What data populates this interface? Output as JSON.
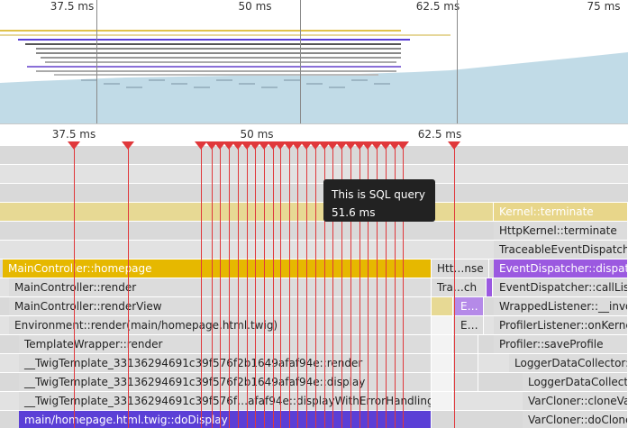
{
  "overview": {
    "ticks": [
      {
        "label": "37.5 ms",
        "ms": 37.5
      },
      {
        "label": "50 ms",
        "ms": 50
      },
      {
        "label": "62.5 ms",
        "ms": 62.5
      },
      {
        "label": "75 ms",
        "ms": 75
      }
    ],
    "selection_ms": [
      32.0,
      87.5
    ]
  },
  "timeline": {
    "ticks": [
      {
        "label": "37.5 ms",
        "ms": 37.5
      },
      {
        "label": "50 ms",
        "ms": 50
      },
      {
        "label": "62.5 ms",
        "ms": 62.5
      }
    ],
    "markers_ms": [
      37.5,
      41.2,
      46.2,
      46.9,
      47.5,
      48.1,
      48.7,
      49.3,
      49.9,
      50.5,
      51.1,
      51.6,
      52.2,
      52.8,
      53.4,
      54.0,
      54.6,
      55.2,
      55.8,
      56.4,
      57.0,
      57.6,
      58.2,
      58.8,
      59.4,
      60.0,
      63.5
    ],
    "tooltip": {
      "title": "This is SQL query",
      "duration": "51.6 ms"
    },
    "bars": [
      {
        "row": 3,
        "start": 0,
        "end": 548,
        "style": "c-lgold",
        "label": ""
      },
      {
        "row": 3,
        "start": 548,
        "end": 697,
        "style": "c-goldtext",
        "label": "Kernel::terminate"
      },
      {
        "row": 4,
        "start": 548,
        "end": 697,
        "style": "c-lgray",
        "label": "HttpKernel::terminate"
      },
      {
        "row": 5,
        "start": 548,
        "end": 697,
        "style": "c-lgray",
        "label": "TraceableEventDispatcher"
      },
      {
        "row": 6,
        "start": 3,
        "end": 479,
        "style": "c-gold",
        "label": "MainController::homepage"
      },
      {
        "row": 6,
        "start": 479,
        "end": 543,
        "style": "c-lgray",
        "label": "Htt…nse"
      },
      {
        "row": 6,
        "start": 548,
        "end": 697,
        "style": "c-purple",
        "label": "EventDispatcher::dispatch"
      },
      {
        "row": 7,
        "start": 10,
        "end": 479,
        "style": "c-lgray",
        "label": "MainController::render"
      },
      {
        "row": 7,
        "start": 479,
        "end": 540,
        "style": "c-lgray",
        "label": "Tra…ch"
      },
      {
        "row": 7,
        "start": 540,
        "end": 543,
        "style": "c-purple",
        "label": ""
      },
      {
        "row": 7,
        "start": 548,
        "end": 697,
        "style": "c-lgray",
        "label": "EventDispatcher::callList"
      },
      {
        "row": 8,
        "start": 10,
        "end": 479,
        "style": "c-lgray",
        "label": "MainController::renderView"
      },
      {
        "row": 8,
        "start": 479,
        "end": 503,
        "style": "c-lgold",
        "label": ""
      },
      {
        "row": 8,
        "start": 505,
        "end": 537,
        "style": "c-lpurple",
        "label": "E…"
      },
      {
        "row": 8,
        "start": 548,
        "end": 697,
        "style": "c-lgray",
        "label": "WrappedListener::__invo"
      },
      {
        "row": 9,
        "start": 10,
        "end": 479,
        "style": "c-lgray",
        "label": "Environment::render(main/homepage.html.twig)"
      },
      {
        "row": 9,
        "start": 479,
        "end": 503,
        "style": "c-white",
        "label": ""
      },
      {
        "row": 9,
        "start": 505,
        "end": 537,
        "style": "c-lgray",
        "label": "E…"
      },
      {
        "row": 9,
        "start": 548,
        "end": 697,
        "style": "c-lgray",
        "label": "ProfilerListener::onKerne"
      },
      {
        "row": 10,
        "start": 21,
        "end": 479,
        "style": "c-lgray",
        "label": "TemplateWrapper::render"
      },
      {
        "row": 10,
        "start": 479,
        "end": 503,
        "style": "c-white",
        "label": ""
      },
      {
        "row": 10,
        "start": 505,
        "end": 531,
        "style": "c-lgray",
        "label": ""
      },
      {
        "row": 10,
        "start": 548,
        "end": 697,
        "style": "c-lgray",
        "label": "Profiler::saveProfile"
      },
      {
        "row": 11,
        "start": 21,
        "end": 479,
        "style": "c-lgray",
        "label": "__TwigTemplate_33136294691c39f576f2b1649afaf94e::render"
      },
      {
        "row": 11,
        "start": 479,
        "end": 503,
        "style": "c-white",
        "label": ""
      },
      {
        "row": 11,
        "start": 505,
        "end": 531,
        "style": "c-lgray",
        "label": ""
      },
      {
        "row": 11,
        "start": 565,
        "end": 697,
        "style": "c-lgray",
        "label": "LoggerDataCollector::"
      },
      {
        "row": 12,
        "start": 21,
        "end": 479,
        "style": "c-lgray",
        "label": "__TwigTemplate_33136294691c39f576f2b1649afaf94e::display"
      },
      {
        "row": 12,
        "start": 479,
        "end": 503,
        "style": "c-white",
        "label": ""
      },
      {
        "row": 12,
        "start": 505,
        "end": 531,
        "style": "c-lgray",
        "label": ""
      },
      {
        "row": 12,
        "start": 580,
        "end": 697,
        "style": "c-lgray",
        "label": "LoggerDataCollector"
      },
      {
        "row": 13,
        "start": 21,
        "end": 479,
        "style": "c-lgray",
        "label": "__TwigTemplate_33136294691c39f576f…afaf94e::displayWithErrorHandling"
      },
      {
        "row": 13,
        "start": 479,
        "end": 503,
        "style": "c-white",
        "label": ""
      },
      {
        "row": 13,
        "start": 580,
        "end": 697,
        "style": "c-lgray",
        "label": "VarCloner::cloneVa"
      },
      {
        "row": 14,
        "start": 21,
        "end": 479,
        "style": "c-blue",
        "label": "main/homepage.html.twig::doDisplay"
      },
      {
        "row": 14,
        "start": 580,
        "end": 697,
        "style": "c-lgray",
        "label": "VarCloner::doClone"
      }
    ]
  }
}
